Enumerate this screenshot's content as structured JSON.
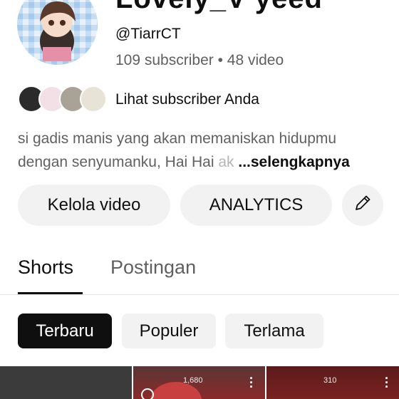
{
  "channel": {
    "name": "Lovely_V yeed",
    "handle": "@TiarrCT",
    "meta": "109 subscriber • 48 video"
  },
  "subscribers": {
    "link_label": "Lihat subscriber Anda"
  },
  "description": {
    "line1": "si gadis manis yang akan memaniskan hidupmu",
    "line2_start": "dengan senyumanku, Hai Hai ",
    "line2_faded": "ak",
    "more_label": "...selengkapnya"
  },
  "actions": {
    "manage_label": "Kelola video",
    "analytics_label": "ANALYTICS",
    "edit_icon": "pencil-icon"
  },
  "tabs": [
    {
      "label": "Shorts",
      "active": true
    },
    {
      "label": "Postingan",
      "active": false
    }
  ],
  "chips": [
    {
      "label": "Terbaru",
      "selected": true
    },
    {
      "label": "Populer",
      "selected": false
    },
    {
      "label": "Terlama",
      "selected": false
    }
  ],
  "thumbnails": [
    {
      "views": ""
    },
    {
      "views": "1,680"
    },
    {
      "views": "310"
    }
  ],
  "colors": {
    "text_primary": "#0f0f0f",
    "text_secondary": "#606060",
    "chip_bg": "#f2f2f2",
    "chip_selected_bg": "#0f0f0f"
  }
}
